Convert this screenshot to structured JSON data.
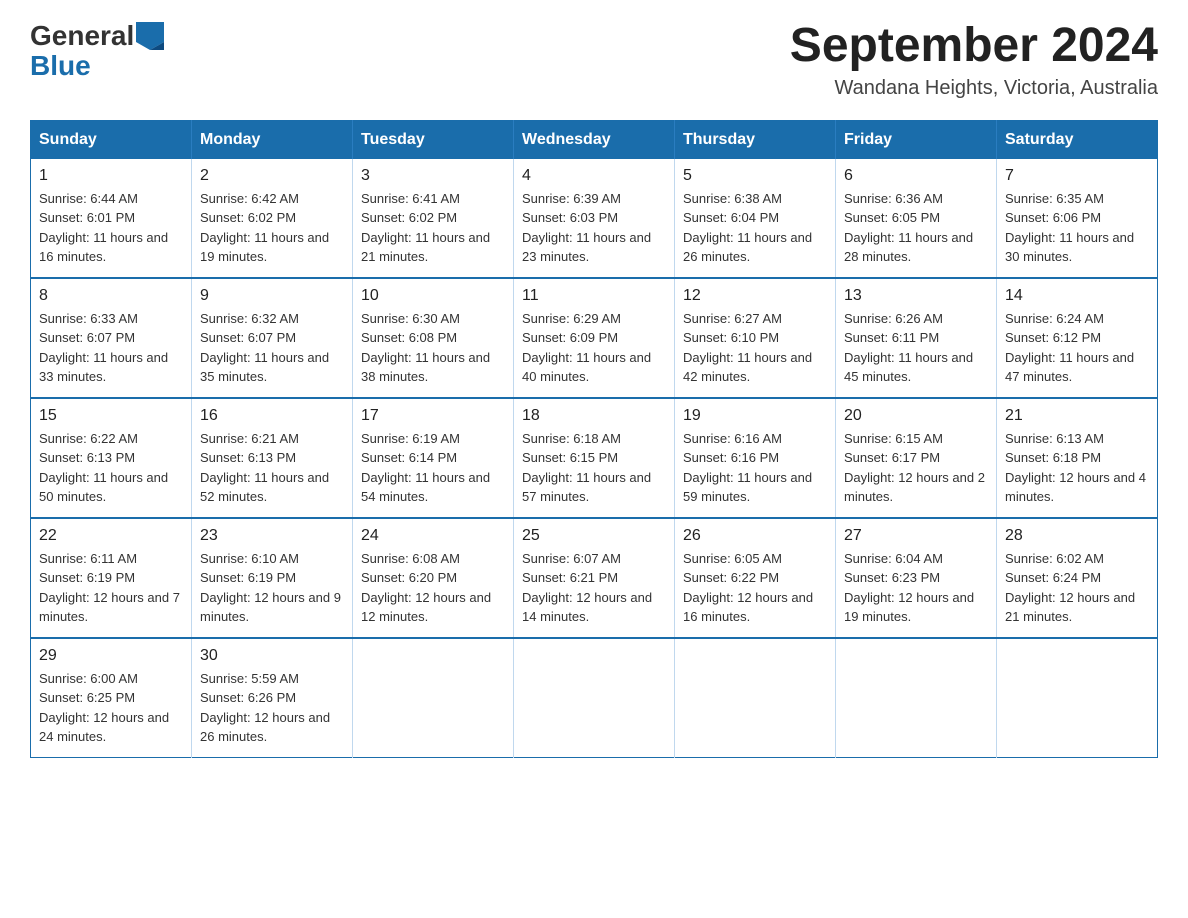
{
  "header": {
    "logo_general": "General",
    "logo_blue": "Blue",
    "month_title": "September 2024",
    "location": "Wandana Heights, Victoria, Australia"
  },
  "days_of_week": [
    "Sunday",
    "Monday",
    "Tuesday",
    "Wednesday",
    "Thursday",
    "Friday",
    "Saturday"
  ],
  "weeks": [
    [
      {
        "day": "1",
        "sunrise": "Sunrise: 6:44 AM",
        "sunset": "Sunset: 6:01 PM",
        "daylight": "Daylight: 11 hours and 16 minutes."
      },
      {
        "day": "2",
        "sunrise": "Sunrise: 6:42 AM",
        "sunset": "Sunset: 6:02 PM",
        "daylight": "Daylight: 11 hours and 19 minutes."
      },
      {
        "day": "3",
        "sunrise": "Sunrise: 6:41 AM",
        "sunset": "Sunset: 6:02 PM",
        "daylight": "Daylight: 11 hours and 21 minutes."
      },
      {
        "day": "4",
        "sunrise": "Sunrise: 6:39 AM",
        "sunset": "Sunset: 6:03 PM",
        "daylight": "Daylight: 11 hours and 23 minutes."
      },
      {
        "day": "5",
        "sunrise": "Sunrise: 6:38 AM",
        "sunset": "Sunset: 6:04 PM",
        "daylight": "Daylight: 11 hours and 26 minutes."
      },
      {
        "day": "6",
        "sunrise": "Sunrise: 6:36 AM",
        "sunset": "Sunset: 6:05 PM",
        "daylight": "Daylight: 11 hours and 28 minutes."
      },
      {
        "day": "7",
        "sunrise": "Sunrise: 6:35 AM",
        "sunset": "Sunset: 6:06 PM",
        "daylight": "Daylight: 11 hours and 30 minutes."
      }
    ],
    [
      {
        "day": "8",
        "sunrise": "Sunrise: 6:33 AM",
        "sunset": "Sunset: 6:07 PM",
        "daylight": "Daylight: 11 hours and 33 minutes."
      },
      {
        "day": "9",
        "sunrise": "Sunrise: 6:32 AM",
        "sunset": "Sunset: 6:07 PM",
        "daylight": "Daylight: 11 hours and 35 minutes."
      },
      {
        "day": "10",
        "sunrise": "Sunrise: 6:30 AM",
        "sunset": "Sunset: 6:08 PM",
        "daylight": "Daylight: 11 hours and 38 minutes."
      },
      {
        "day": "11",
        "sunrise": "Sunrise: 6:29 AM",
        "sunset": "Sunset: 6:09 PM",
        "daylight": "Daylight: 11 hours and 40 minutes."
      },
      {
        "day": "12",
        "sunrise": "Sunrise: 6:27 AM",
        "sunset": "Sunset: 6:10 PM",
        "daylight": "Daylight: 11 hours and 42 minutes."
      },
      {
        "day": "13",
        "sunrise": "Sunrise: 6:26 AM",
        "sunset": "Sunset: 6:11 PM",
        "daylight": "Daylight: 11 hours and 45 minutes."
      },
      {
        "day": "14",
        "sunrise": "Sunrise: 6:24 AM",
        "sunset": "Sunset: 6:12 PM",
        "daylight": "Daylight: 11 hours and 47 minutes."
      }
    ],
    [
      {
        "day": "15",
        "sunrise": "Sunrise: 6:22 AM",
        "sunset": "Sunset: 6:13 PM",
        "daylight": "Daylight: 11 hours and 50 minutes."
      },
      {
        "day": "16",
        "sunrise": "Sunrise: 6:21 AM",
        "sunset": "Sunset: 6:13 PM",
        "daylight": "Daylight: 11 hours and 52 minutes."
      },
      {
        "day": "17",
        "sunrise": "Sunrise: 6:19 AM",
        "sunset": "Sunset: 6:14 PM",
        "daylight": "Daylight: 11 hours and 54 minutes."
      },
      {
        "day": "18",
        "sunrise": "Sunrise: 6:18 AM",
        "sunset": "Sunset: 6:15 PM",
        "daylight": "Daylight: 11 hours and 57 minutes."
      },
      {
        "day": "19",
        "sunrise": "Sunrise: 6:16 AM",
        "sunset": "Sunset: 6:16 PM",
        "daylight": "Daylight: 11 hours and 59 minutes."
      },
      {
        "day": "20",
        "sunrise": "Sunrise: 6:15 AM",
        "sunset": "Sunset: 6:17 PM",
        "daylight": "Daylight: 12 hours and 2 minutes."
      },
      {
        "day": "21",
        "sunrise": "Sunrise: 6:13 AM",
        "sunset": "Sunset: 6:18 PM",
        "daylight": "Daylight: 12 hours and 4 minutes."
      }
    ],
    [
      {
        "day": "22",
        "sunrise": "Sunrise: 6:11 AM",
        "sunset": "Sunset: 6:19 PM",
        "daylight": "Daylight: 12 hours and 7 minutes."
      },
      {
        "day": "23",
        "sunrise": "Sunrise: 6:10 AM",
        "sunset": "Sunset: 6:19 PM",
        "daylight": "Daylight: 12 hours and 9 minutes."
      },
      {
        "day": "24",
        "sunrise": "Sunrise: 6:08 AM",
        "sunset": "Sunset: 6:20 PM",
        "daylight": "Daylight: 12 hours and 12 minutes."
      },
      {
        "day": "25",
        "sunrise": "Sunrise: 6:07 AM",
        "sunset": "Sunset: 6:21 PM",
        "daylight": "Daylight: 12 hours and 14 minutes."
      },
      {
        "day": "26",
        "sunrise": "Sunrise: 6:05 AM",
        "sunset": "Sunset: 6:22 PM",
        "daylight": "Daylight: 12 hours and 16 minutes."
      },
      {
        "day": "27",
        "sunrise": "Sunrise: 6:04 AM",
        "sunset": "Sunset: 6:23 PM",
        "daylight": "Daylight: 12 hours and 19 minutes."
      },
      {
        "day": "28",
        "sunrise": "Sunrise: 6:02 AM",
        "sunset": "Sunset: 6:24 PM",
        "daylight": "Daylight: 12 hours and 21 minutes."
      }
    ],
    [
      {
        "day": "29",
        "sunrise": "Sunrise: 6:00 AM",
        "sunset": "Sunset: 6:25 PM",
        "daylight": "Daylight: 12 hours and 24 minutes."
      },
      {
        "day": "30",
        "sunrise": "Sunrise: 5:59 AM",
        "sunset": "Sunset: 6:26 PM",
        "daylight": "Daylight: 12 hours and 26 minutes."
      },
      null,
      null,
      null,
      null,
      null
    ]
  ]
}
